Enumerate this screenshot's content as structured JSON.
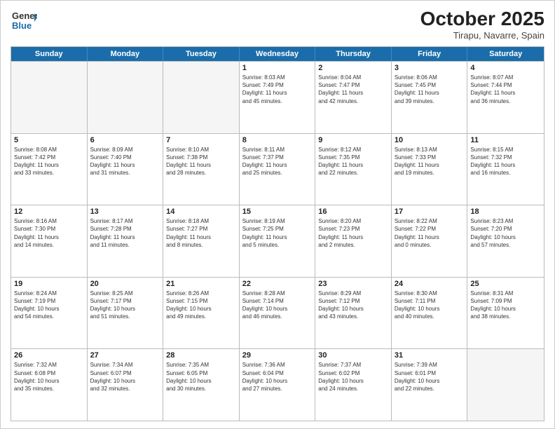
{
  "header": {
    "logo_general": "General",
    "logo_blue": "Blue",
    "month_title": "October 2025",
    "location": "Tirapu, Navarre, Spain"
  },
  "weekdays": [
    "Sunday",
    "Monday",
    "Tuesday",
    "Wednesday",
    "Thursday",
    "Friday",
    "Saturday"
  ],
  "rows": [
    [
      {
        "day": "",
        "lines": [],
        "empty": true
      },
      {
        "day": "",
        "lines": [],
        "empty": true
      },
      {
        "day": "",
        "lines": [],
        "empty": true
      },
      {
        "day": "1",
        "lines": [
          "Sunrise: 8:03 AM",
          "Sunset: 7:49 PM",
          "Daylight: 11 hours",
          "and 45 minutes."
        ]
      },
      {
        "day": "2",
        "lines": [
          "Sunrise: 8:04 AM",
          "Sunset: 7:47 PM",
          "Daylight: 11 hours",
          "and 42 minutes."
        ]
      },
      {
        "day": "3",
        "lines": [
          "Sunrise: 8:06 AM",
          "Sunset: 7:45 PM",
          "Daylight: 11 hours",
          "and 39 minutes."
        ]
      },
      {
        "day": "4",
        "lines": [
          "Sunrise: 8:07 AM",
          "Sunset: 7:44 PM",
          "Daylight: 11 hours",
          "and 36 minutes."
        ]
      }
    ],
    [
      {
        "day": "5",
        "lines": [
          "Sunrise: 8:08 AM",
          "Sunset: 7:42 PM",
          "Daylight: 11 hours",
          "and 33 minutes."
        ]
      },
      {
        "day": "6",
        "lines": [
          "Sunrise: 8:09 AM",
          "Sunset: 7:40 PM",
          "Daylight: 11 hours",
          "and 31 minutes."
        ]
      },
      {
        "day": "7",
        "lines": [
          "Sunrise: 8:10 AM",
          "Sunset: 7:38 PM",
          "Daylight: 11 hours",
          "and 28 minutes."
        ]
      },
      {
        "day": "8",
        "lines": [
          "Sunrise: 8:11 AM",
          "Sunset: 7:37 PM",
          "Daylight: 11 hours",
          "and 25 minutes."
        ]
      },
      {
        "day": "9",
        "lines": [
          "Sunrise: 8:12 AM",
          "Sunset: 7:35 PM",
          "Daylight: 11 hours",
          "and 22 minutes."
        ]
      },
      {
        "day": "10",
        "lines": [
          "Sunrise: 8:13 AM",
          "Sunset: 7:33 PM",
          "Daylight: 11 hours",
          "and 19 minutes."
        ]
      },
      {
        "day": "11",
        "lines": [
          "Sunrise: 8:15 AM",
          "Sunset: 7:32 PM",
          "Daylight: 11 hours",
          "and 16 minutes."
        ]
      }
    ],
    [
      {
        "day": "12",
        "lines": [
          "Sunrise: 8:16 AM",
          "Sunset: 7:30 PM",
          "Daylight: 11 hours",
          "and 14 minutes."
        ]
      },
      {
        "day": "13",
        "lines": [
          "Sunrise: 8:17 AM",
          "Sunset: 7:28 PM",
          "Daylight: 11 hours",
          "and 11 minutes."
        ]
      },
      {
        "day": "14",
        "lines": [
          "Sunrise: 8:18 AM",
          "Sunset: 7:27 PM",
          "Daylight: 11 hours",
          "and 8 minutes."
        ]
      },
      {
        "day": "15",
        "lines": [
          "Sunrise: 8:19 AM",
          "Sunset: 7:25 PM",
          "Daylight: 11 hours",
          "and 5 minutes."
        ]
      },
      {
        "day": "16",
        "lines": [
          "Sunrise: 8:20 AM",
          "Sunset: 7:23 PM",
          "Daylight: 11 hours",
          "and 2 minutes."
        ]
      },
      {
        "day": "17",
        "lines": [
          "Sunrise: 8:22 AM",
          "Sunset: 7:22 PM",
          "Daylight: 11 hours",
          "and 0 minutes."
        ]
      },
      {
        "day": "18",
        "lines": [
          "Sunrise: 8:23 AM",
          "Sunset: 7:20 PM",
          "Daylight: 10 hours",
          "and 57 minutes."
        ]
      }
    ],
    [
      {
        "day": "19",
        "lines": [
          "Sunrise: 8:24 AM",
          "Sunset: 7:19 PM",
          "Daylight: 10 hours",
          "and 54 minutes."
        ]
      },
      {
        "day": "20",
        "lines": [
          "Sunrise: 8:25 AM",
          "Sunset: 7:17 PM",
          "Daylight: 10 hours",
          "and 51 minutes."
        ]
      },
      {
        "day": "21",
        "lines": [
          "Sunrise: 8:26 AM",
          "Sunset: 7:15 PM",
          "Daylight: 10 hours",
          "and 49 minutes."
        ]
      },
      {
        "day": "22",
        "lines": [
          "Sunrise: 8:28 AM",
          "Sunset: 7:14 PM",
          "Daylight: 10 hours",
          "and 46 minutes."
        ]
      },
      {
        "day": "23",
        "lines": [
          "Sunrise: 8:29 AM",
          "Sunset: 7:12 PM",
          "Daylight: 10 hours",
          "and 43 minutes."
        ]
      },
      {
        "day": "24",
        "lines": [
          "Sunrise: 8:30 AM",
          "Sunset: 7:11 PM",
          "Daylight: 10 hours",
          "and 40 minutes."
        ]
      },
      {
        "day": "25",
        "lines": [
          "Sunrise: 8:31 AM",
          "Sunset: 7:09 PM",
          "Daylight: 10 hours",
          "and 38 minutes."
        ]
      }
    ],
    [
      {
        "day": "26",
        "lines": [
          "Sunrise: 7:32 AM",
          "Sunset: 6:08 PM",
          "Daylight: 10 hours",
          "and 35 minutes."
        ]
      },
      {
        "day": "27",
        "lines": [
          "Sunrise: 7:34 AM",
          "Sunset: 6:07 PM",
          "Daylight: 10 hours",
          "and 32 minutes."
        ]
      },
      {
        "day": "28",
        "lines": [
          "Sunrise: 7:35 AM",
          "Sunset: 6:05 PM",
          "Daylight: 10 hours",
          "and 30 minutes."
        ]
      },
      {
        "day": "29",
        "lines": [
          "Sunrise: 7:36 AM",
          "Sunset: 6:04 PM",
          "Daylight: 10 hours",
          "and 27 minutes."
        ]
      },
      {
        "day": "30",
        "lines": [
          "Sunrise: 7:37 AM",
          "Sunset: 6:02 PM",
          "Daylight: 10 hours",
          "and 24 minutes."
        ]
      },
      {
        "day": "31",
        "lines": [
          "Sunrise: 7:39 AM",
          "Sunset: 6:01 PM",
          "Daylight: 10 hours",
          "and 22 minutes."
        ]
      },
      {
        "day": "",
        "lines": [],
        "empty": true
      }
    ]
  ]
}
